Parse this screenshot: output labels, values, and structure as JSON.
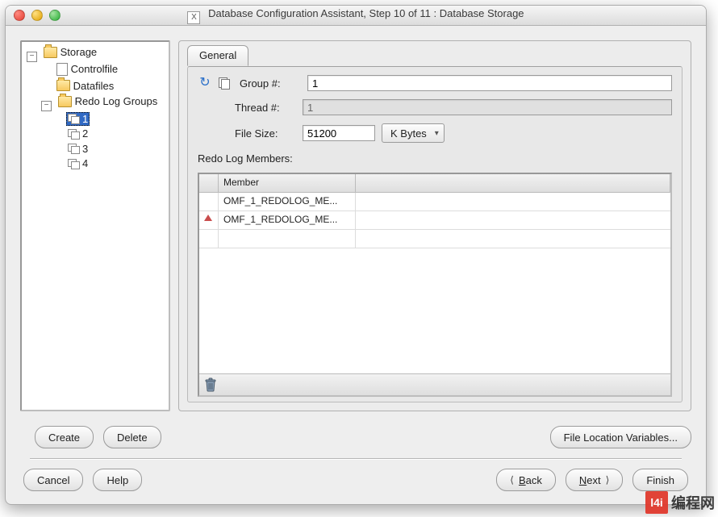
{
  "window": {
    "title": "Database Configuration Assistant, Step 10 of 11 : Database Storage",
    "app_icon_letter": "X"
  },
  "tree": {
    "root": "Storage",
    "controlfile": "Controlfile",
    "datafiles": "Datafiles",
    "redo_groups": "Redo Log Groups",
    "groups": [
      "1",
      "2",
      "3",
      "4"
    ],
    "selected_group_index": 0
  },
  "tab": {
    "general": "General"
  },
  "form": {
    "group_label": "Group #:",
    "group_value": "1",
    "thread_label": "Thread #:",
    "thread_value": "1",
    "filesize_label": "File Size:",
    "filesize_value": "51200",
    "filesize_unit": "K Bytes"
  },
  "members": {
    "section_label": "Redo Log Members:",
    "header": "Member",
    "rows": [
      {
        "marked": false,
        "value": "OMF_1_REDOLOG_ME..."
      },
      {
        "marked": true,
        "value": "OMF_1_REDOLOG_ME..."
      },
      {
        "marked": false,
        "value": ""
      }
    ]
  },
  "buttons": {
    "create": "Create",
    "delete": "Delete",
    "file_loc": "File Location Variables...",
    "cancel": "Cancel",
    "help": "Help",
    "back": "Back",
    "next": "Next",
    "finish": "Finish"
  },
  "watermark": {
    "badge": "l4i",
    "text": "编程网"
  }
}
